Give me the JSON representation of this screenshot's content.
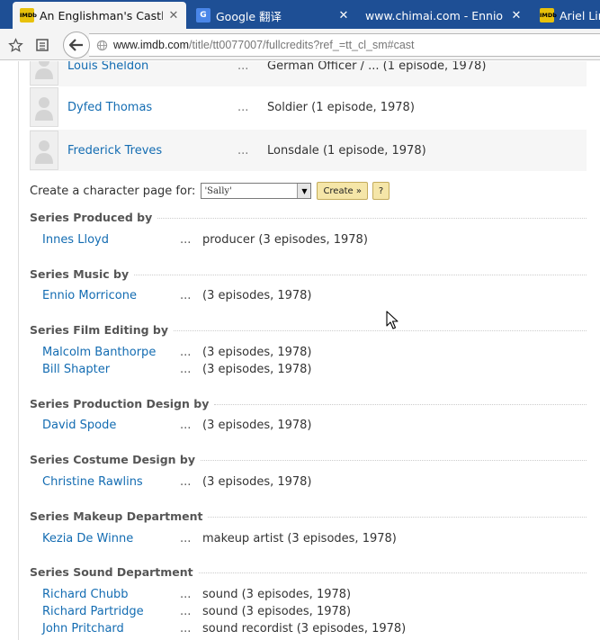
{
  "browser": {
    "tabs": [
      {
        "title": "An Englishman's Castle...",
        "favicon": "IMDb",
        "active": true
      },
      {
        "title": "Google 翻译",
        "favicon": "G",
        "active": false
      },
      {
        "title": "www.chimai.com - Ennio ...",
        "favicon": "",
        "active": false
      },
      {
        "title": "Ariel Lim",
        "favicon": "IMDb",
        "active": false
      }
    ],
    "url_domain": "www.imdb.com",
    "url_path": "/title/tt0077007/fullcredits?ref_=tt_cl_sm#cast"
  },
  "cast": [
    {
      "name": "Louis Sheldon",
      "dots": "...",
      "character": "German Officer / ... (1 episode, 1978)"
    },
    {
      "name": "Dyfed Thomas",
      "dots": "...",
      "character": "Soldier (1 episode, 1978)"
    },
    {
      "name": "Frederick Treves",
      "dots": "...",
      "character": "Lonsdale (1 episode, 1978)"
    }
  ],
  "character_page": {
    "label": "Create a character page for:",
    "selected": "'Sally'",
    "create_button": "Create »",
    "help_button": "?"
  },
  "sections": [
    {
      "title": "Series Produced by",
      "credits": [
        {
          "name": "Innes Lloyd",
          "dots": "...",
          "role": "producer (3 episodes, 1978)"
        }
      ]
    },
    {
      "title": "Series Music by",
      "credits": [
        {
          "name": "Ennio Morricone",
          "dots": "...",
          "role": "(3 episodes, 1978)"
        }
      ]
    },
    {
      "title": "Series Film Editing by",
      "credits": [
        {
          "name": "Malcolm Banthorpe",
          "dots": "...",
          "role": "(3 episodes, 1978)"
        },
        {
          "name": "Bill Shapter",
          "dots": "...",
          "role": "(3 episodes, 1978)"
        }
      ]
    },
    {
      "title": "Series Production Design by",
      "credits": [
        {
          "name": "David Spode",
          "dots": "...",
          "role": "(3 episodes, 1978)"
        }
      ]
    },
    {
      "title": "Series Costume Design by",
      "credits": [
        {
          "name": "Christine Rawlins",
          "dots": "...",
          "role": "(3 episodes, 1978)"
        }
      ]
    },
    {
      "title": "Series Makeup Department",
      "credits": [
        {
          "name": "Kezia De Winne",
          "dots": "...",
          "role": "makeup artist (3 episodes, 1978)"
        }
      ]
    },
    {
      "title": "Series Sound Department",
      "credits": [
        {
          "name": "Richard Chubb",
          "dots": "...",
          "role": "sound (3 episodes, 1978)"
        },
        {
          "name": "Richard Partridge",
          "dots": "...",
          "role": "sound (3 episodes, 1978)"
        },
        {
          "name": "John Pritchard",
          "dots": "...",
          "role": "sound recordist (3 episodes, 1978)"
        }
      ]
    }
  ],
  "colors": {
    "link": "#136cb2",
    "tabbar": "#1e4f95",
    "imdb_yellow": "#e8c10a"
  }
}
